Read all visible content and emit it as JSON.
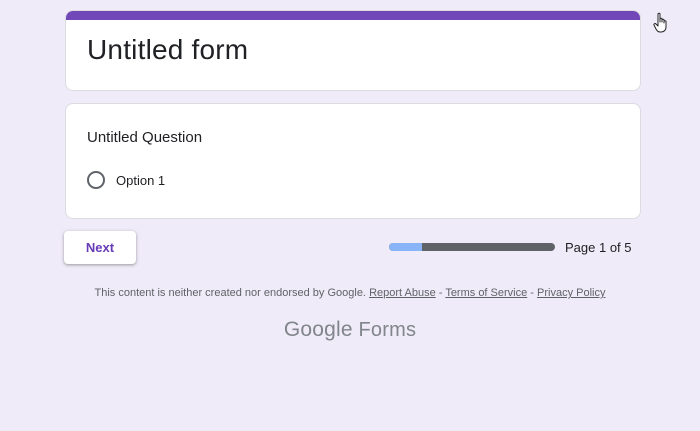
{
  "form": {
    "title": "Untitled form",
    "accent_color": "#7248b9"
  },
  "question": {
    "title": "Untitled Question",
    "options": [
      {
        "label": "Option 1",
        "selected": false
      }
    ]
  },
  "navigation": {
    "next_label": "Next",
    "progress": {
      "fraction": 0.2,
      "label": "Page 1 of 5"
    }
  },
  "footer": {
    "disclaimer": "This content is neither created nor endorsed by Google.",
    "report_abuse": "Report Abuse",
    "separator": "-",
    "terms": "Terms of Service",
    "privacy": "Privacy Policy",
    "brand_google": "Google",
    "brand_forms": "Forms"
  },
  "icons": {
    "cursor": "hand-pointer-icon"
  }
}
